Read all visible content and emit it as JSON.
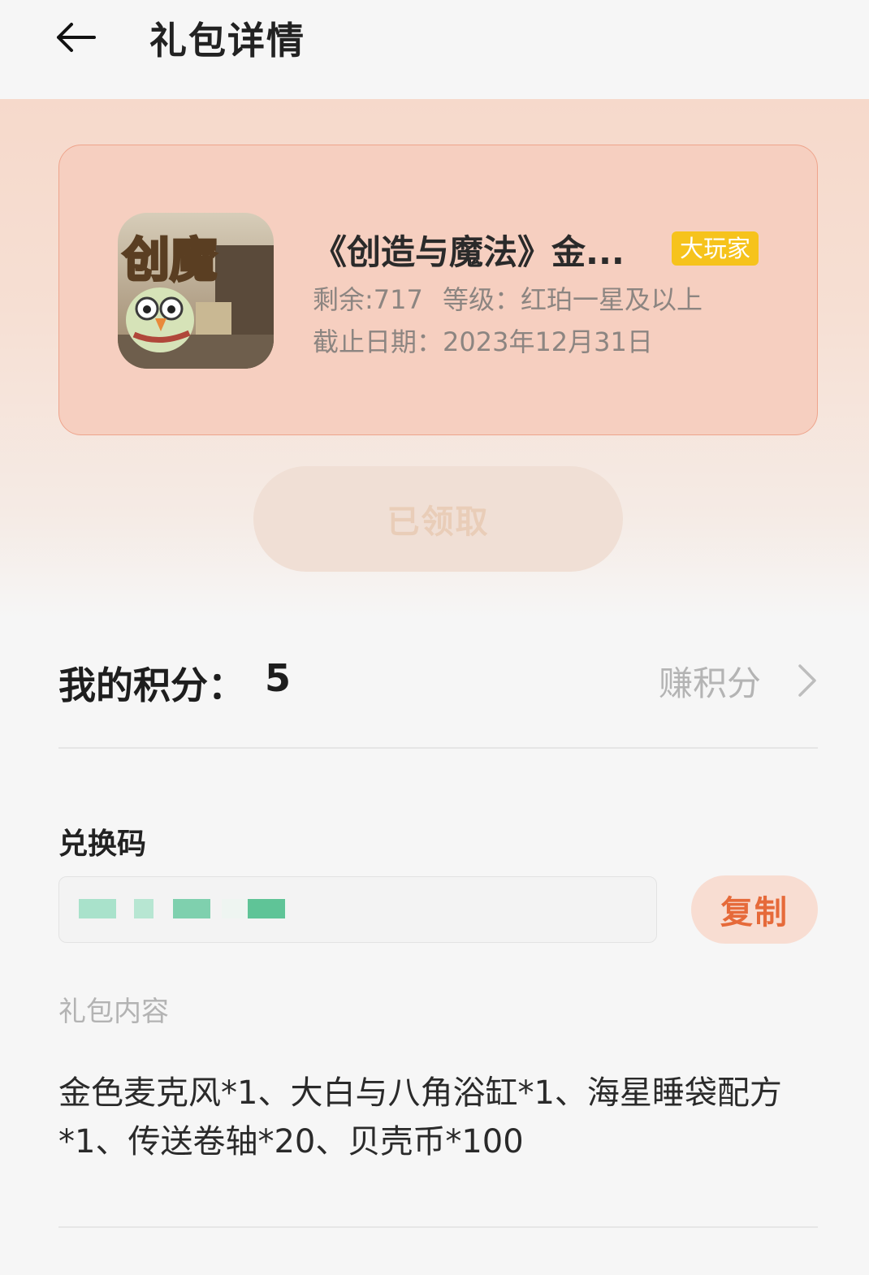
{
  "header": {
    "title": "礼包详情",
    "back_icon": "arrow-left-icon"
  },
  "gift": {
    "game_name": "《创造与魔法》金...",
    "badge": "大玩家",
    "remaining": "剩余:717",
    "level": "等级：红珀一星及以上",
    "deadline": "截止日期：2023年12月31日",
    "icon_text": "创魔",
    "claim_status": "已领取"
  },
  "points": {
    "label": "我的积分：",
    "value": "5",
    "earn_label": "赚积分"
  },
  "code": {
    "title": "兑换码",
    "copy_label": "复制"
  },
  "contents": {
    "title": "礼包内容",
    "text": "金色麦克风*1、大白与八角浴缸*1、海星睡袋配方*1、传送卷轴*20、贝壳币*100"
  },
  "colors": {
    "accent": "#e66a3a",
    "badge": "#f6c31c",
    "card_bg": "#f6cfc0",
    "card_border": "#eea48c"
  }
}
